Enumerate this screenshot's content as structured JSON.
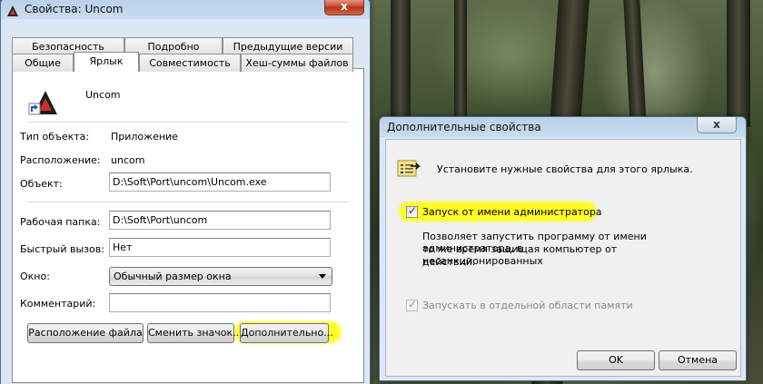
{
  "props_dialog": {
    "title": "Свойства: Uncom",
    "close_label": "x",
    "tabs_top": [
      "Безопасность",
      "Подробно",
      "Предыдущие версии"
    ],
    "tabs_bottom": [
      "Общие",
      "Ярлык",
      "Совместимость",
      "Хеш-суммы файлов"
    ],
    "app_name": "Uncom",
    "fields": {
      "type_label": "Тип объекта:",
      "type_value": "Приложение",
      "location_label": "Расположение:",
      "location_value": "uncom",
      "object_label": "Объект:",
      "object_value": "D:\\Soft\\Port\\uncom\\Uncom.exe",
      "workdir_label": "Рабочая папка:",
      "workdir_value": "D:\\Soft\\Port\\uncom",
      "hotkey_label": "Быстрый вызов:",
      "hotkey_value": "Нет",
      "window_label": "Окно:",
      "window_value": "Обычный размер окна",
      "comment_label": "Комментарий:",
      "comment_value": ""
    },
    "buttons": {
      "file_location": "Расположение файла",
      "change_icon": "Сменить значок...",
      "advanced": "Дополнительно..."
    }
  },
  "adv_dialog": {
    "title": "Дополнительные свойства",
    "close_label": "x",
    "intro": "Установите нужные свойства для этого ярлыка.",
    "run_as_admin_label": "Запуск от имени администратора",
    "run_as_admin_checked": true,
    "run_as_admin_desc_1": "Позволяет запустить программу от имени администратора, в",
    "run_as_admin_desc_2": "то же время защищая компьютер от несанкционированных",
    "run_as_admin_desc_3": "действий.",
    "separate_memory_label": "Запускать в отдельной области памяти",
    "separate_memory_checked": true,
    "ok_label": "OK",
    "cancel_label": "Отмена"
  },
  "colors": {
    "highlight": "#ffff00",
    "titlebar": "#b9d1ea",
    "close_button": "#c7452a"
  }
}
